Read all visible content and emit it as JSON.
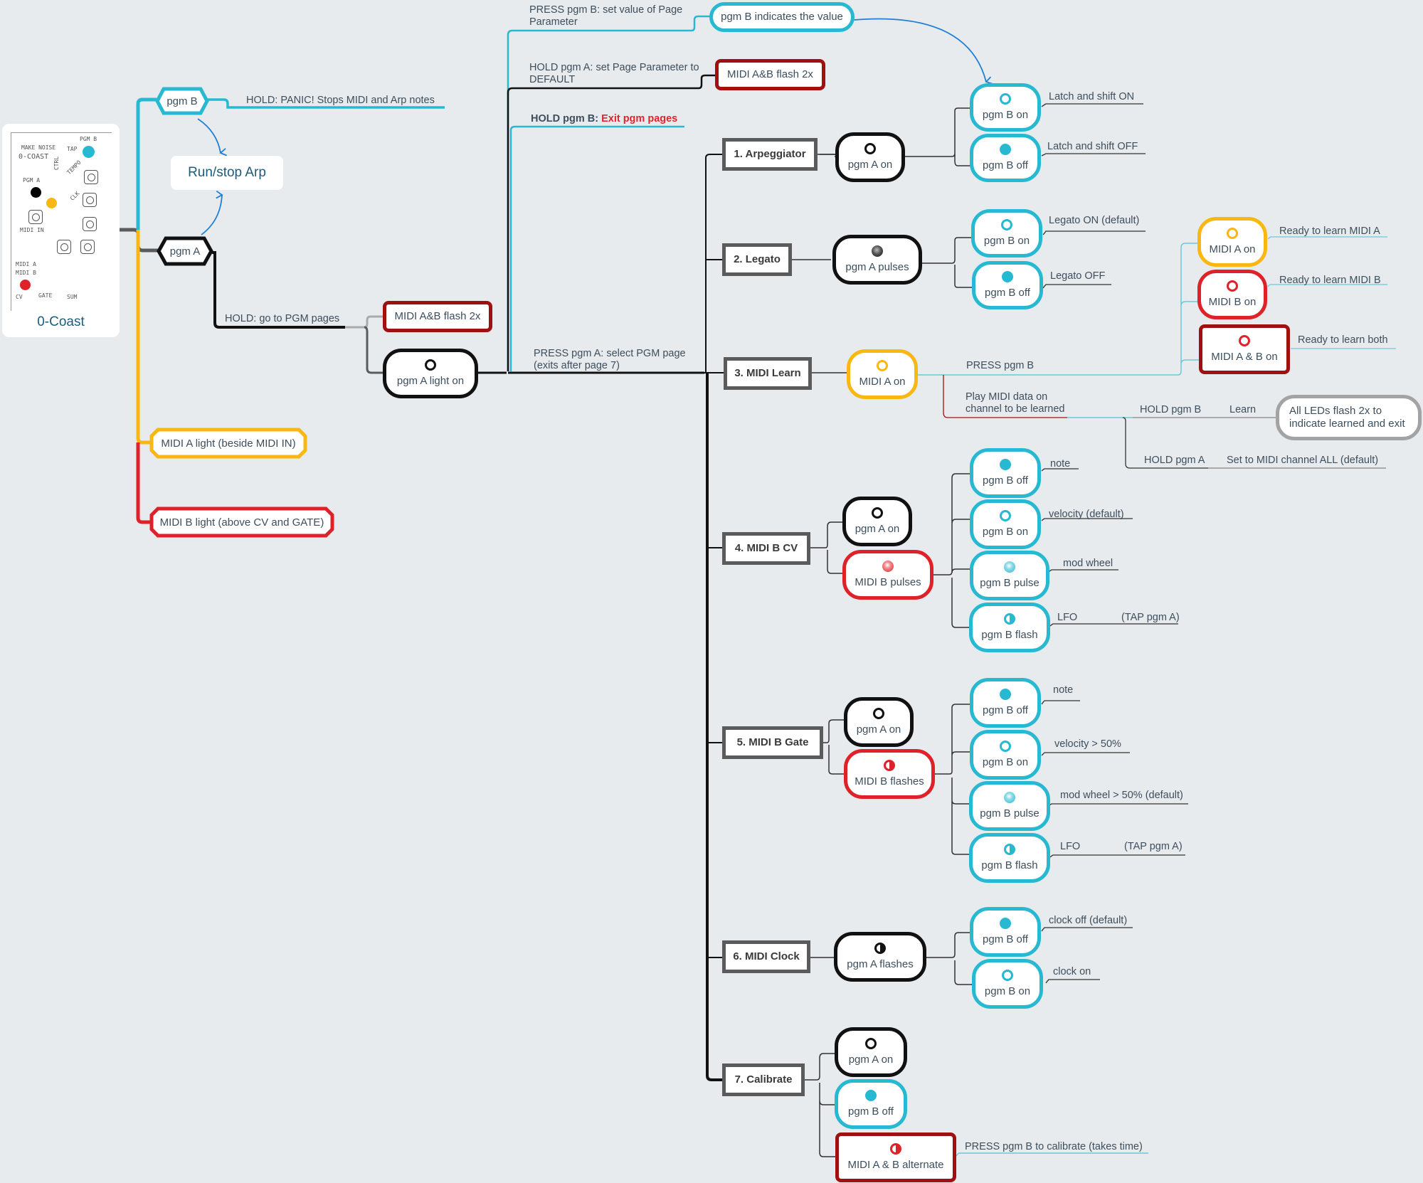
{
  "device": {
    "name": "0-Coast",
    "panel_labels": {
      "brand": "MAKE NOISE",
      "model": "0-COAST",
      "pgm_a": "PGM A",
      "pgm_b": "PGM B",
      "tap": "TAP",
      "midi_in": "MIDI IN",
      "ctrl": "CTRL",
      "tempo": "TEMPO",
      "clk": "CLK",
      "midi_a": "MIDI A",
      "midi_b": "MIDI B",
      "cv": "CV",
      "gate": "GATE",
      "sum": "SUM"
    }
  },
  "colors": {
    "background": "#e8ebee",
    "pgm_b": "#27b9d1",
    "pgm_a": "#111111",
    "midi_a": "#f8b712",
    "midi_b": "#df2229",
    "midi_ab": "#a01010",
    "page": "#5b5b5b",
    "arrow": "#1e7fd8",
    "exit_text": "#e0252b"
  },
  "root_branches": {
    "pgm_b": {
      "label": "pgm B",
      "hold_note": "HOLD: PANIC! Stops MIDI and Arp notes"
    },
    "run_stop": "Run/stop Arp",
    "pgm_a": {
      "label": "pgm A",
      "hold_note": "HOLD: go to PGM pages"
    },
    "midi_a_light": "MIDI A light (beside MIDI IN)",
    "midi_b_light": "MIDI B light (above CV and GATE)"
  },
  "pgm_mode": {
    "entry_flash": "MIDI A&B flash 2x",
    "entry_node": {
      "led": "open-black",
      "label": "pgm A light on"
    },
    "press_b_note": "PRESS pgm B: set value of Page Parameter",
    "press_b_result": "pgm B indicates the value",
    "hold_a_note": "HOLD pgm A: set Page Parameter to DEFAULT",
    "hold_a_result": "MIDI A&B flash 2x",
    "hold_b_prefix": "HOLD pgm B:",
    "hold_b_exit": "Exit pgm pages",
    "press_a_note": "PRESS pgm A: select PGM page (exits after page 7)"
  },
  "pages": [
    {
      "title": "1. Arpeggiator",
      "indicators": [
        {
          "led": "open-black",
          "label": "pgm A on"
        }
      ],
      "options": [
        {
          "led": "open-teal",
          "label": "pgm B on",
          "meaning": "Latch and shift ON"
        },
        {
          "led": "filled-teal",
          "label": "pgm B off",
          "meaning": "Latch and shift OFF"
        }
      ]
    },
    {
      "title": "2. Legato",
      "indicators": [
        {
          "led": "pulse-black",
          "label": "pgm A pulses"
        }
      ],
      "options": [
        {
          "led": "open-teal",
          "label": "pgm B on",
          "meaning": "Legato ON (default)"
        },
        {
          "led": "filled-teal",
          "label": "pgm B off",
          "meaning": "Legato OFF"
        }
      ]
    },
    {
      "title": "3. MIDI Learn",
      "indicators": [
        {
          "led": "open-yellow",
          "label": "MIDI A on"
        }
      ],
      "press_b": "PRESS pgm B",
      "options": [
        {
          "led": "open-yellow",
          "label": "MIDI A on",
          "meaning": "Ready to learn MIDI A"
        },
        {
          "led": "open-red",
          "label": "MIDI B on",
          "meaning": "Ready to learn MIDI B"
        },
        {
          "led": "open-red",
          "label": "MIDI A & B on",
          "meaning": "Ready to learn both"
        }
      ],
      "play_note": "Play MIDI data on channel to be learned",
      "hold_b": "HOLD pgm B",
      "learn": "Learn",
      "learn_result": "All LEDs flash 2x to indicate learned and exit",
      "hold_a": "HOLD pgm A",
      "hold_a_result": "Set to MIDI channel ALL (default)"
    },
    {
      "title": "4. MIDI B CV",
      "indicators": [
        {
          "led": "open-black",
          "label": "pgm A on"
        },
        {
          "led": "pulse-red",
          "label": "MIDI B pulses"
        }
      ],
      "options": [
        {
          "led": "filled-teal",
          "label": "pgm B off",
          "meaning": "note"
        },
        {
          "led": "open-teal",
          "label": "pgm B on",
          "meaning": "velocity (default)"
        },
        {
          "led": "pulse-teal",
          "label": "pgm B pulse",
          "meaning": "mod wheel"
        },
        {
          "led": "half-teal",
          "label": "pgm B flash",
          "meaning": "LFO",
          "extra": "(TAP pgm A)"
        }
      ]
    },
    {
      "title": "5. MIDI B Gate",
      "indicators": [
        {
          "led": "open-black",
          "label": "pgm A on"
        },
        {
          "led": "half-red",
          "label": "MIDI B flashes"
        }
      ],
      "options": [
        {
          "led": "filled-teal",
          "label": "pgm B off",
          "meaning": "note"
        },
        {
          "led": "open-teal",
          "label": "pgm B on",
          "meaning": "velocity > 50%"
        },
        {
          "led": "pulse-teal",
          "label": "pgm B pulse",
          "meaning": "mod wheel > 50% (default)"
        },
        {
          "led": "half-teal",
          "label": "pgm B flash",
          "meaning": "LFO",
          "extra": "(TAP pgm A)"
        }
      ]
    },
    {
      "title": "6. MIDI Clock",
      "indicators": [
        {
          "led": "half-black",
          "label": "pgm A flashes"
        }
      ],
      "options": [
        {
          "led": "filled-teal",
          "label": "pgm B off",
          "meaning": "clock off (default)"
        },
        {
          "led": "open-teal",
          "label": "pgm B on",
          "meaning": "clock on"
        }
      ]
    },
    {
      "title": "7. Calibrate",
      "indicators": [
        {
          "led": "open-black",
          "label": "pgm A on"
        },
        {
          "led": "filled-teal",
          "label": "pgm B off"
        },
        {
          "led": "half-red",
          "label": "MIDI A & B alternate"
        }
      ],
      "note": "PRESS pgm B to calibrate (takes time)"
    }
  ]
}
